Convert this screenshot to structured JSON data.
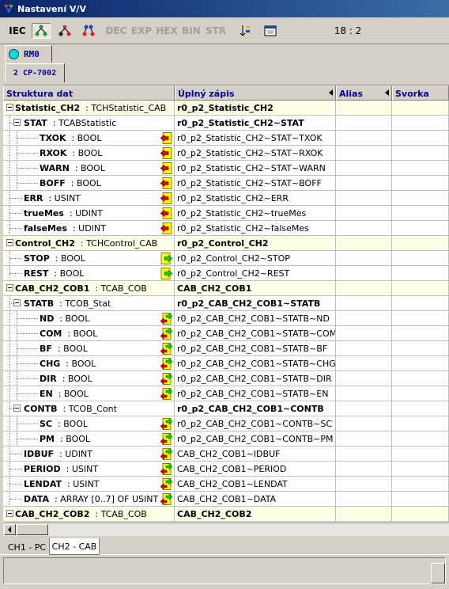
{
  "window": {
    "title": "Nastavení V/V"
  },
  "toolbar": {
    "iec": "IEC",
    "dec": "DEC",
    "exp": "EXP",
    "hex": "HEX",
    "bin": "BIN",
    "str": "STR",
    "position": "18 : 2"
  },
  "station": {
    "label": "RM0"
  },
  "module": {
    "label": "2 CP-7002"
  },
  "columns": {
    "struct": "Struktura dat",
    "full": "Úplný zápis",
    "alias": "Alias",
    "svorka": "Svorka"
  },
  "rows": [
    {
      "name": "Statistic_CH2",
      "type": "  : TCHStatistic_CAB",
      "full": "r0_p2_Statistic_CH2",
      "level": 0,
      "toggle": true,
      "icon": "",
      "hl": true,
      "bold": true
    },
    {
      "name": "STAT",
      "type": "  : TCABStatistic",
      "full": "r0_p2_Statistic_CH2~STAT",
      "level": 1,
      "toggle": true,
      "icon": "",
      "hl": false,
      "bold": true
    },
    {
      "name": "TXOK",
      "type": "  : BOOL",
      "full": "r0_p2_Statistic_CH2~STAT~TXOK",
      "level": 2,
      "toggle": false,
      "icon": "in",
      "hl": false,
      "bold": false
    },
    {
      "name": "RXOK",
      "type": "  : BOOL",
      "full": "r0_p2_Statistic_CH2~STAT~RXOK",
      "level": 2,
      "toggle": false,
      "icon": "in",
      "hl": false,
      "bold": false
    },
    {
      "name": "WARN",
      "type": "  : BOOL",
      "full": "r0_p2_Statistic_CH2~STAT~WARN",
      "level": 2,
      "toggle": false,
      "icon": "in",
      "hl": false,
      "bold": false
    },
    {
      "name": "BOFF",
      "type": "  : BOOL",
      "full": "r0_p2_Statistic_CH2~STAT~BOFF",
      "level": 2,
      "toggle": false,
      "icon": "in",
      "hl": false,
      "bold": false
    },
    {
      "name": "ERR",
      "type": "  : USINT",
      "full": "r0_p2_Statistic_CH2~ERR",
      "level": 1,
      "toggle": false,
      "icon": "in",
      "hl": false,
      "bold": false
    },
    {
      "name": "trueMes",
      "type": "  : UDINT",
      "full": "r0_p2_Statistic_CH2~trueMes",
      "level": 1,
      "toggle": false,
      "icon": "in",
      "hl": false,
      "bold": false
    },
    {
      "name": "falseMes",
      "type": "  : UDINT",
      "full": "r0_p2_Statistic_CH2~falseMes",
      "level": 1,
      "toggle": false,
      "icon": "in",
      "hl": false,
      "bold": false
    },
    {
      "name": "Control_CH2",
      "type": "  : TCHControl_CAB",
      "full": "r0_p2_Control_CH2",
      "level": 0,
      "toggle": true,
      "icon": "",
      "hl": true,
      "bold": true
    },
    {
      "name": "STOP",
      "type": "  : BOOL",
      "full": "r0_p2_Control_CH2~STOP",
      "level": 1,
      "toggle": false,
      "icon": "out",
      "hl": false,
      "bold": false
    },
    {
      "name": "REST",
      "type": "  : BOOL",
      "full": "r0_p2_Control_CH2~REST",
      "level": 1,
      "toggle": false,
      "icon": "out",
      "hl": false,
      "bold": false
    },
    {
      "name": "CAB_CH2_COB1",
      "type": "  : TCAB_COB",
      "full": "CAB_CH2_COB1",
      "level": 0,
      "toggle": true,
      "icon": "",
      "hl": true,
      "bold": true
    },
    {
      "name": "STATB",
      "type": "  : TCOB_Stat",
      "full": "r0_p2_CAB_CH2_COB1~STATB",
      "level": 1,
      "toggle": true,
      "icon": "",
      "hl": false,
      "bold": true
    },
    {
      "name": "ND",
      "type": "  : BOOL",
      "full": "r0_p2_CAB_CH2_COB1~STATB~ND",
      "level": 2,
      "toggle": false,
      "icon": "io",
      "hl": false,
      "bold": false
    },
    {
      "name": "COM",
      "type": "  : BOOL",
      "full": "r0_p2_CAB_CH2_COB1~STATB~COM",
      "level": 2,
      "toggle": false,
      "icon": "io",
      "hl": false,
      "bold": false
    },
    {
      "name": "BF",
      "type": "  : BOOL",
      "full": "r0_p2_CAB_CH2_COB1~STATB~BF",
      "level": 2,
      "toggle": false,
      "icon": "io",
      "hl": false,
      "bold": false
    },
    {
      "name": "CHG",
      "type": "  : BOOL",
      "full": "r0_p2_CAB_CH2_COB1~STATB~CHG",
      "level": 2,
      "toggle": false,
      "icon": "io",
      "hl": false,
      "bold": false
    },
    {
      "name": "DIR",
      "type": "  : BOOL",
      "full": "r0_p2_CAB_CH2_COB1~STATB~DIR",
      "level": 2,
      "toggle": false,
      "icon": "io",
      "hl": false,
      "bold": false
    },
    {
      "name": "EN",
      "type": "  : BOOL",
      "full": "r0_p2_CAB_CH2_COB1~STATB~EN",
      "level": 2,
      "toggle": false,
      "icon": "io",
      "hl": false,
      "bold": false
    },
    {
      "name": "CONTB",
      "type": "  : TCOB_Cont",
      "full": "r0_p2_CAB_CH2_COB1~CONTB",
      "level": 1,
      "toggle": true,
      "icon": "",
      "hl": false,
      "bold": true
    },
    {
      "name": "SC",
      "type": "  : BOOL",
      "full": "r0_p2_CAB_CH2_COB1~CONTB~SC",
      "level": 2,
      "toggle": false,
      "icon": "io",
      "hl": false,
      "bold": false
    },
    {
      "name": "PM",
      "type": "  : BOOL",
      "full": "r0_p2_CAB_CH2_COB1~CONTB~PM",
      "level": 2,
      "toggle": false,
      "icon": "io",
      "hl": false,
      "bold": false
    },
    {
      "name": "IDBUF",
      "type": "  : UDINT",
      "full": "CAB_CH2_COB1~IDBUF",
      "level": 1,
      "toggle": false,
      "icon": "io",
      "hl": false,
      "bold": false
    },
    {
      "name": "PERIOD",
      "type": "  : USINT",
      "full": "CAB_CH2_COB1~PERIOD",
      "level": 1,
      "toggle": false,
      "icon": "io",
      "hl": false,
      "bold": false
    },
    {
      "name": "LENDAT",
      "type": "  : USINT",
      "full": "CAB_CH2_COB1~LENDAT",
      "level": 1,
      "toggle": false,
      "icon": "io",
      "hl": false,
      "bold": false
    },
    {
      "name": "DATA",
      "type": "  : ARRAY [0..7] OF USINT",
      "full": "CAB_CH2_COB1~DATA",
      "level": 1,
      "toggle": false,
      "icon": "io",
      "hl": false,
      "bold": false
    },
    {
      "name": "CAB_CH2_COB2",
      "type": "  : TCAB_COB",
      "full": "CAB_CH2_COB2",
      "level": 0,
      "toggle": true,
      "icon": "",
      "hl": true,
      "bold": true
    }
  ],
  "bottom_tabs": [
    "CH1 - PC",
    "CH2 - CAB"
  ]
}
